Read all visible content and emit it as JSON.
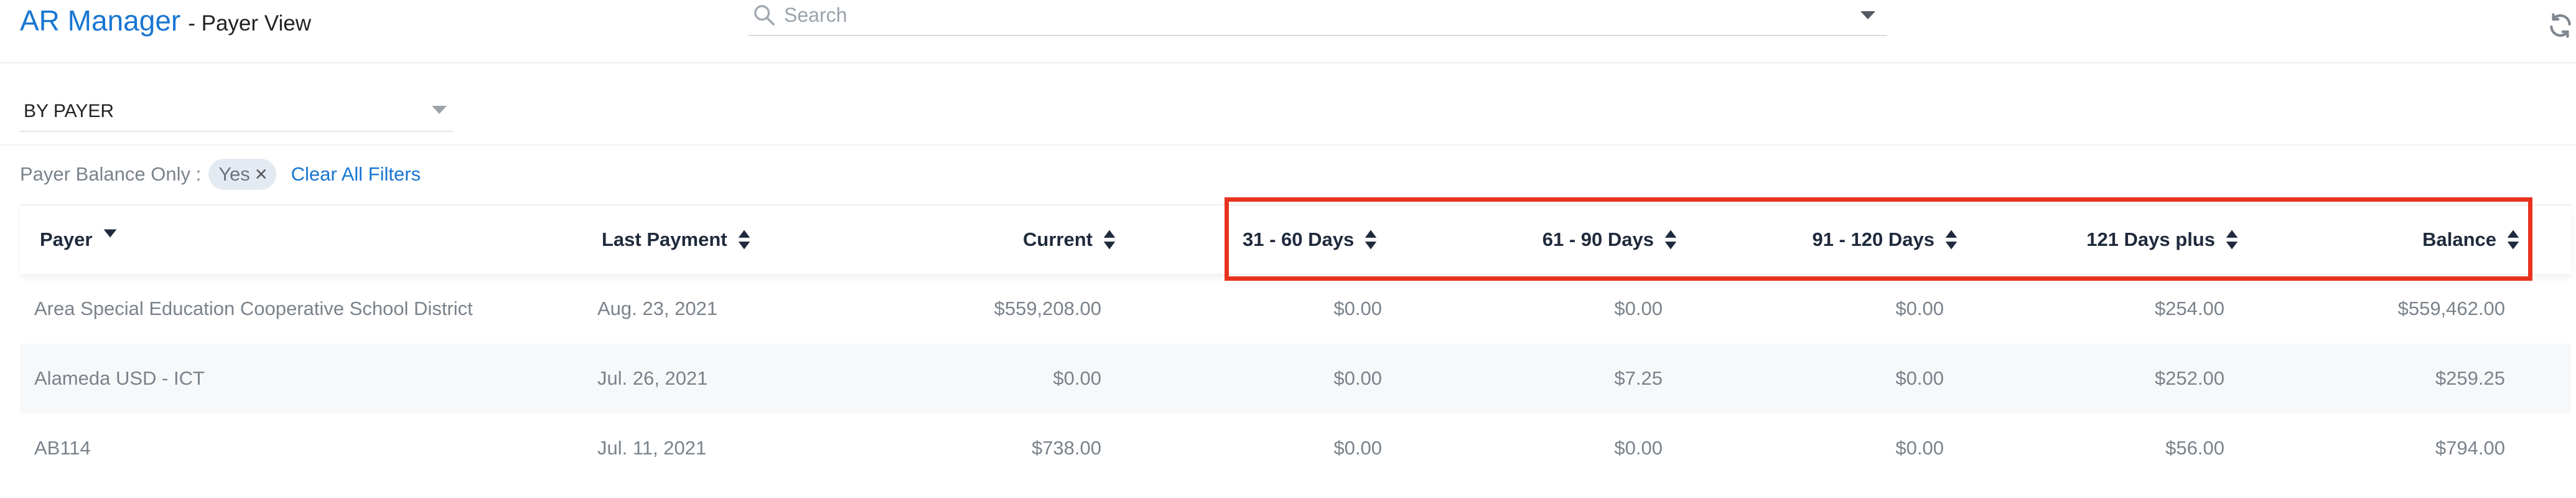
{
  "header": {
    "app_name": "AR Manager",
    "app_subtitle": "- Payer View",
    "search_placeholder": "Search"
  },
  "filters": {
    "group_by_value": "BY PAYER",
    "active_filter_label": "Payer Balance Only :",
    "active_filter_value": "Yes",
    "clear_all_label": "Clear All Filters"
  },
  "table": {
    "columns": {
      "payer": "Payer",
      "last_payment": "Last Payment",
      "current": "Current",
      "d31_60": "31 - 60 Days",
      "d61_90": "61 - 90 Days",
      "d91_120": "91 - 120 Days",
      "d121_plus": "121 Days plus",
      "balance": "Balance"
    },
    "rows": [
      {
        "payer": "Area Special Education Cooperative School District",
        "last_payment": "Aug. 23, 2021",
        "current": "$559,208.00",
        "d31_60": "$0.00",
        "d61_90": "$0.00",
        "d91_120": "$0.00",
        "d121_plus": "$254.00",
        "balance": "$559,462.00"
      },
      {
        "payer": "Alameda USD - ICT",
        "last_payment": "Jul. 26, 2021",
        "current": "$0.00",
        "d31_60": "$0.00",
        "d61_90": "$7.25",
        "d91_120": "$0.00",
        "d121_plus": "$252.00",
        "balance": "$259.25"
      },
      {
        "payer": "AB114",
        "last_payment": "Jul. 11, 2021",
        "current": "$738.00",
        "d31_60": "$0.00",
        "d61_90": "$0.00",
        "d91_120": "$0.00",
        "d121_plus": "$56.00",
        "balance": "$794.00"
      }
    ]
  },
  "colors": {
    "accent": "#1976d2",
    "highlight_box": "#e8321e",
    "header_text": "#1f2a3c",
    "cell_text": "#7a828b"
  }
}
